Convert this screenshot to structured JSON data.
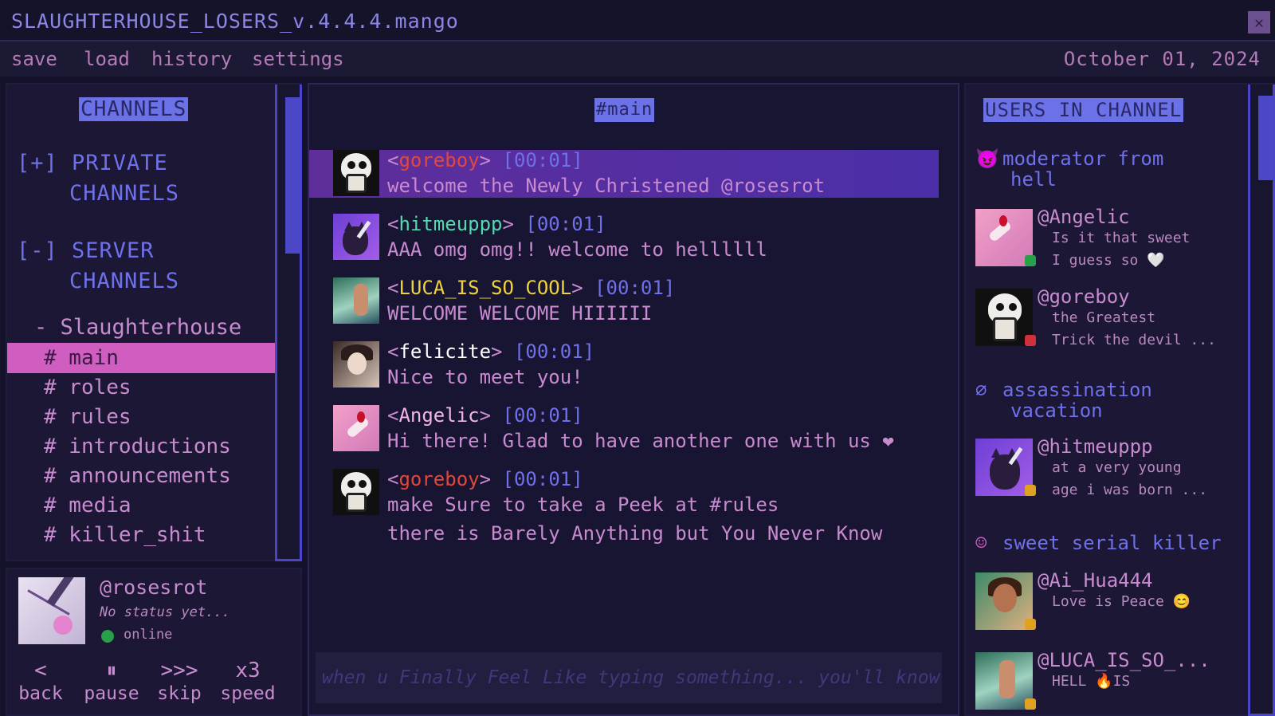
{
  "window": {
    "title": "SLAUGHTERHOUSE_LOSERS_v.4.4.4.mango"
  },
  "menu": {
    "items": [
      "save",
      "load",
      "history",
      "settings"
    ],
    "date": "October 01, 2024"
  },
  "sidebar": {
    "heading": "CHANNELS",
    "private_group": [
      "[+] PRIVATE",
      "CHANNELS"
    ],
    "server_group": [
      "[-] SERVER",
      "CHANNELS"
    ],
    "server_name": "- Slaughterhouse",
    "channels": [
      "# main",
      "# roles",
      "# rules",
      "# introductions",
      "# announcements",
      "# media",
      "# killer_shit"
    ],
    "active_channel": "# main"
  },
  "profile": {
    "handle": "@rosesrot",
    "status": "No status yet...",
    "presence": "online",
    "controls": [
      {
        "symbol": "<",
        "label": "back"
      },
      {
        "symbol": "⏸",
        "label": "pause"
      },
      {
        "symbol": ">>>",
        "label": "skip"
      },
      {
        "symbol": "x3",
        "label": "speed"
      }
    ]
  },
  "chat": {
    "heading": "#main",
    "messages": [
      {
        "user": "goreboy",
        "time": "[00:01]",
        "name_color": "#e3473a",
        "text": "welcome the Newly Christened @rosesrot"
      },
      {
        "user": "hitmeuppp",
        "time": "[00:01]",
        "name_color": "#54d9b0",
        "text": "AAA omg omg!! welcome to hellllll"
      },
      {
        "user": "LUCA_IS_SO_COOL",
        "time": "[00:01]",
        "name_color": "#f0d23c",
        "text": "WELCOME WELCOME HIIIIII"
      },
      {
        "user": "felicite",
        "time": "[00:01]",
        "name_color": "#ffffff",
        "text": "Nice to meet you!"
      },
      {
        "user": "Angelic",
        "time": "[00:01]",
        "name_color": "#f2b6e6",
        "text": "Hi there! Glad to have another one with us ❤"
      },
      {
        "user": "goreboy",
        "time": "[00:01]",
        "name_color": "#e3473a",
        "text": "make Sure to take a Peek at #rules",
        "text2": "there is Barely Anything but You Never Know"
      }
    ],
    "input_placeholder": "when u Finally Feel Like typing something... you'll know"
  },
  "users": {
    "heading": "USERS IN CHANNEL",
    "roles": [
      {
        "icon": "😈",
        "name_line1": "moderator from",
        "name_line2": "hell"
      },
      {
        "icon": "∅",
        "name_line1": "assassination",
        "name_line2": "vacation"
      },
      {
        "icon": "☺",
        "name_line1": "sweet serial killer",
        "name_line2": ""
      }
    ],
    "members": [
      {
        "name": "@Angelic",
        "line1": "Is it that sweet",
        "line2": "I guess so 🤍",
        "status_color": "#28a04a"
      },
      {
        "name": "@goreboy",
        "line1": "the Greatest",
        "line2": "Trick the devil ...",
        "status_color": "#d0303a"
      },
      {
        "name": "@hitmeuppp",
        "line1": "at a very young",
        "line2": "age i was born ...",
        "status_color": "#e0a020"
      },
      {
        "name": "@Ai_Hua444",
        "line1": "Love is Peace 😊",
        "line2": "",
        "status_color": "#e0a020"
      },
      {
        "name": "@LUCA_IS_SO_...",
        "line1": "HELL 🔥IS",
        "line2": "",
        "status_color": "#e0a020"
      }
    ]
  }
}
